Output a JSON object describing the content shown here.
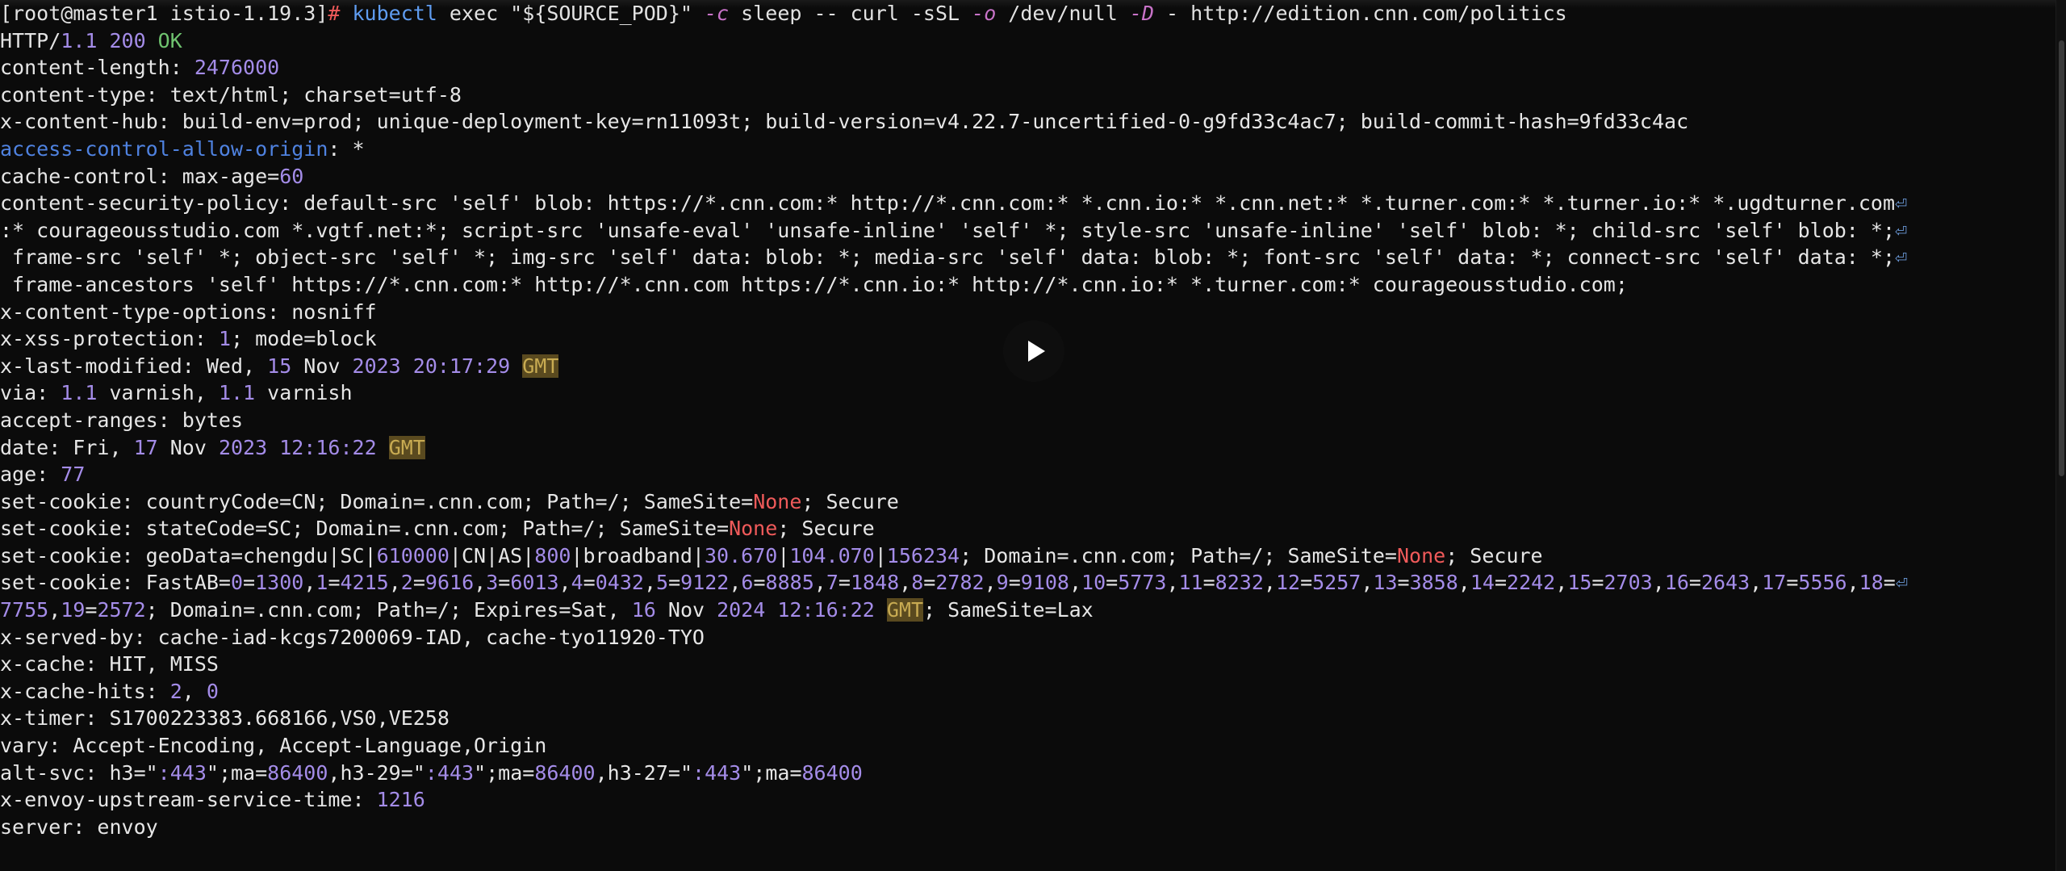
{
  "terminal": {
    "lines": [
      [
        [
          "[root@master1 istio-1.19.3]",
          "def"
        ],
        [
          "# ",
          "red"
        ],
        [
          "kubectl",
          "cmd"
        ],
        [
          " exec \"${SOURCE_POD}\" ",
          "def"
        ],
        [
          "-c",
          "opt"
        ],
        [
          " sleep -- curl -sSL ",
          "def"
        ],
        [
          "-o",
          "opt"
        ],
        [
          " /dev/null ",
          "def"
        ],
        [
          "-D",
          "opt"
        ],
        [
          " - http://edition.cnn.com/politics",
          "def"
        ]
      ],
      [
        [
          "HTTP/",
          "def"
        ],
        [
          "1.1 200",
          "num"
        ],
        [
          " OK",
          "green"
        ]
      ],
      [
        [
          "content-length: ",
          "key"
        ],
        [
          "2476000",
          "num"
        ]
      ],
      [
        [
          "content-type: text/html; charset=utf-8",
          "key"
        ]
      ],
      [
        [
          "x-content-hub: build-env=prod; unique-deployment-key=rn11093t; build-version=v4.22.7-uncertified-0-g9fd33c4ac7; build-commit-hash=9fd33c4ac",
          "key"
        ]
      ],
      [
        [
          "access-control-allow-origin",
          "blue"
        ],
        [
          ": *",
          "key"
        ]
      ],
      [
        [
          "cache-control: max-age=",
          "key"
        ],
        [
          "60",
          "num"
        ]
      ],
      [
        [
          "content-security-policy: default-src 'self' blob: https://*.cnn.com:* http://*.cnn.com:* *.cnn.io:* *.cnn.net:* *.turner.com:* *.turner.io:* *.ugdturner.com",
          "key"
        ],
        [
          "⏎",
          "wrap"
        ]
      ],
      [
        [
          ":* courageousstudio.com *.vgtf.net:*; script-src 'unsafe-eval' 'unsafe-inline' 'self' *; style-src 'unsafe-inline' 'self' blob: *; child-src 'self' blob: *;",
          "key"
        ],
        [
          "⏎",
          "wrap"
        ]
      ],
      [
        [
          " frame-src 'self' *; object-src 'self' *; img-src 'self' data: blob: *; media-src 'self' data: blob: *; font-src 'self' data: *; connect-src 'self' data: *;",
          "key"
        ],
        [
          "⏎",
          "wrap"
        ]
      ],
      [
        [
          " frame-ancestors 'self' https://*.cnn.com:* http://*.cnn.com https://*.cnn.io:* http://*.cnn.io:* *.turner.com:* courageousstudio.com;",
          "key"
        ]
      ],
      [
        [
          "x-content-type-options: nosniff",
          "key"
        ]
      ],
      [
        [
          "x-xss-protection: ",
          "key"
        ],
        [
          "1",
          "num"
        ],
        [
          "; mode=block",
          "key"
        ]
      ],
      [
        [
          "x-last-modified: Wed, ",
          "key"
        ],
        [
          "15",
          "num"
        ],
        [
          " Nov ",
          "key"
        ],
        [
          "2023 20:17:29",
          "num"
        ],
        [
          " ",
          "key"
        ],
        [
          "GMT",
          "gmt"
        ]
      ],
      [
        [
          "via: ",
          "key"
        ],
        [
          "1.1",
          "num"
        ],
        [
          " varnish, ",
          "key"
        ],
        [
          "1.1",
          "num"
        ],
        [
          " varnish",
          "key"
        ]
      ],
      [
        [
          "accept-ranges: bytes",
          "key"
        ]
      ],
      [
        [
          "date: Fri, ",
          "key"
        ],
        [
          "17",
          "num"
        ],
        [
          " Nov ",
          "key"
        ],
        [
          "2023 12:16:22",
          "num"
        ],
        [
          " ",
          "key"
        ],
        [
          "GMT",
          "gmt"
        ]
      ],
      [
        [
          "age: ",
          "key"
        ],
        [
          "77",
          "num"
        ]
      ],
      [
        [
          "set-cookie: countryCode=CN; Domain=.cnn.com; Path=/; SameSite=",
          "key"
        ],
        [
          "None",
          "red"
        ],
        [
          "; Secure",
          "key"
        ]
      ],
      [
        [
          "set-cookie: stateCode=SC; Domain=.cnn.com; Path=/; SameSite=",
          "key"
        ],
        [
          "None",
          "red"
        ],
        [
          "; Secure",
          "key"
        ]
      ],
      [
        [
          "set-cookie: geoData=chengdu|SC|",
          "key"
        ],
        [
          "610000",
          "num"
        ],
        [
          "|CN|AS|",
          "key"
        ],
        [
          "800",
          "num"
        ],
        [
          "|broadband|",
          "key"
        ],
        [
          "30.670",
          "num"
        ],
        [
          "|",
          "key"
        ],
        [
          "104.070",
          "num"
        ],
        [
          "|",
          "key"
        ],
        [
          "156234",
          "num"
        ],
        [
          "; Domain=.cnn.com; Path=/; SameSite=",
          "key"
        ],
        [
          "None",
          "red"
        ],
        [
          "; Secure",
          "key"
        ]
      ],
      [
        [
          "set-cookie: FastAB=",
          "key"
        ],
        [
          "0",
          "num"
        ],
        [
          "=",
          "key"
        ],
        [
          "1300",
          "num"
        ],
        [
          ",",
          "key"
        ],
        [
          "1",
          "num"
        ],
        [
          "=",
          "key"
        ],
        [
          "4215",
          "num"
        ],
        [
          ",",
          "key"
        ],
        [
          "2",
          "num"
        ],
        [
          "=",
          "key"
        ],
        [
          "9616",
          "num"
        ],
        [
          ",",
          "key"
        ],
        [
          "3",
          "num"
        ],
        [
          "=",
          "key"
        ],
        [
          "6013",
          "num"
        ],
        [
          ",",
          "key"
        ],
        [
          "4",
          "num"
        ],
        [
          "=",
          "key"
        ],
        [
          "0432",
          "num"
        ],
        [
          ",",
          "key"
        ],
        [
          "5",
          "num"
        ],
        [
          "=",
          "key"
        ],
        [
          "9122",
          "num"
        ],
        [
          ",",
          "key"
        ],
        [
          "6",
          "num"
        ],
        [
          "=",
          "key"
        ],
        [
          "8885",
          "num"
        ],
        [
          ",",
          "key"
        ],
        [
          "7",
          "num"
        ],
        [
          "=",
          "key"
        ],
        [
          "1848",
          "num"
        ],
        [
          ",",
          "key"
        ],
        [
          "8",
          "num"
        ],
        [
          "=",
          "key"
        ],
        [
          "2782",
          "num"
        ],
        [
          ",",
          "key"
        ],
        [
          "9",
          "num"
        ],
        [
          "=",
          "key"
        ],
        [
          "9108",
          "num"
        ],
        [
          ",",
          "key"
        ],
        [
          "10",
          "num"
        ],
        [
          "=",
          "key"
        ],
        [
          "5773",
          "num"
        ],
        [
          ",",
          "key"
        ],
        [
          "11",
          "num"
        ],
        [
          "=",
          "key"
        ],
        [
          "8232",
          "num"
        ],
        [
          ",",
          "key"
        ],
        [
          "12",
          "num"
        ],
        [
          "=",
          "key"
        ],
        [
          "5257",
          "num"
        ],
        [
          ",",
          "key"
        ],
        [
          "13",
          "num"
        ],
        [
          "=",
          "key"
        ],
        [
          "3858",
          "num"
        ],
        [
          ",",
          "key"
        ],
        [
          "14",
          "num"
        ],
        [
          "=",
          "key"
        ],
        [
          "2242",
          "num"
        ],
        [
          ",",
          "key"
        ],
        [
          "15",
          "num"
        ],
        [
          "=",
          "key"
        ],
        [
          "2703",
          "num"
        ],
        [
          ",",
          "key"
        ],
        [
          "16",
          "num"
        ],
        [
          "=",
          "key"
        ],
        [
          "2643",
          "num"
        ],
        [
          ",",
          "key"
        ],
        [
          "17",
          "num"
        ],
        [
          "=",
          "key"
        ],
        [
          "5556",
          "num"
        ],
        [
          ",",
          "key"
        ],
        [
          "18",
          "num"
        ],
        [
          "=",
          "key"
        ],
        [
          "⏎",
          "wrap"
        ]
      ],
      [
        [
          "7755",
          "num"
        ],
        [
          ",",
          "key"
        ],
        [
          "19",
          "num"
        ],
        [
          "=",
          "key"
        ],
        [
          "2572",
          "num"
        ],
        [
          "; Domain=.cnn.com; Path=/; Expires=Sat, ",
          "key"
        ],
        [
          "16",
          "num"
        ],
        [
          " Nov ",
          "key"
        ],
        [
          "2024 12:16:22",
          "num"
        ],
        [
          " ",
          "key"
        ],
        [
          "GMT",
          "gmt"
        ],
        [
          "; SameSite=Lax",
          "key"
        ]
      ],
      [
        [
          "x-served-by: cache-iad-kcgs7200069-IAD, cache-tyo11920-TYO",
          "key"
        ]
      ],
      [
        [
          "x-cache: HIT, MISS",
          "key"
        ]
      ],
      [
        [
          "x-cache-hits: ",
          "key"
        ],
        [
          "2",
          "num"
        ],
        [
          ", ",
          "key"
        ],
        [
          "0",
          "num"
        ]
      ],
      [
        [
          "x-timer: S1700223383.668166,VS0,VE258",
          "key"
        ]
      ],
      [
        [
          "vary: Accept-Encoding, Accept-Language,Origin",
          "key"
        ]
      ],
      [
        [
          "alt-svc: h3=\"",
          "key"
        ],
        [
          ":443",
          "num"
        ],
        [
          "\";ma=",
          "key"
        ],
        [
          "86400",
          "num"
        ],
        [
          ",h3-29=\"",
          "key"
        ],
        [
          ":443",
          "num"
        ],
        [
          "\";ma=",
          "key"
        ],
        [
          "86400",
          "num"
        ],
        [
          ",h3-27=\"",
          "key"
        ],
        [
          ":443",
          "num"
        ],
        [
          "\";ma=",
          "key"
        ],
        [
          "86400",
          "num"
        ]
      ],
      [
        [
          "x-envoy-upstream-service-time: ",
          "key"
        ],
        [
          "1216",
          "num"
        ]
      ],
      [
        [
          "server: envoy",
          "key"
        ]
      ]
    ]
  },
  "colors": {
    "background": "#0b0b0b",
    "text": "#e2e2e2",
    "number": "#a48ce8",
    "gmt_highlight": "#c8ab52",
    "none_value": "#ef5a5a",
    "ok_status": "#6fc36f",
    "prompt_command": "#5f9cf0"
  },
  "overlay": {
    "play_icon": "play-icon"
  }
}
